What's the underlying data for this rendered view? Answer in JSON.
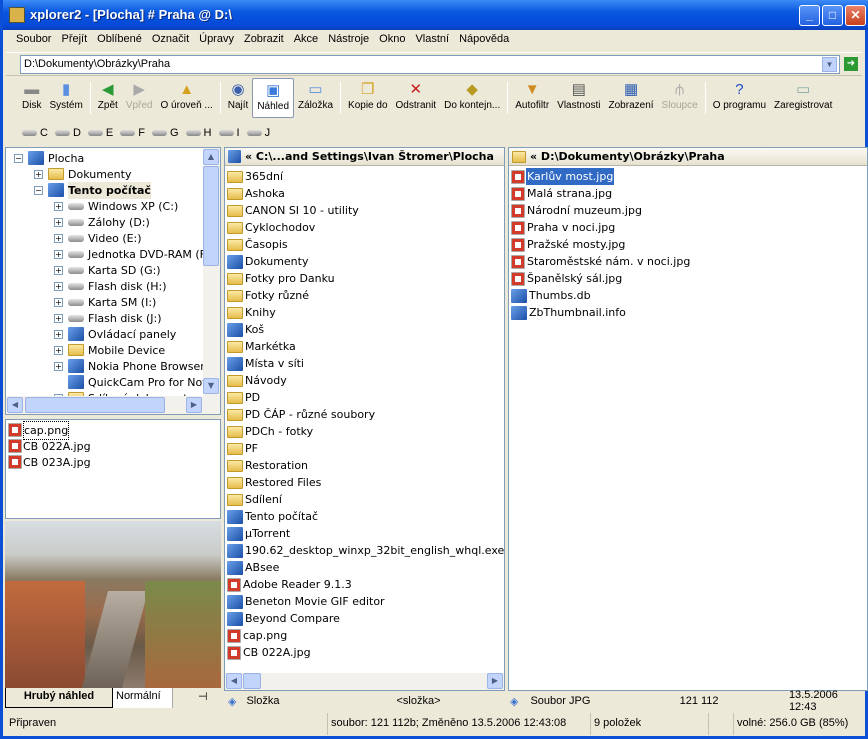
{
  "window": {
    "title": "xplorer2 - [Plocha] # Praha @ D:\\"
  },
  "menu": [
    "Soubor",
    "Přejít",
    "Oblíbené",
    "Označit",
    "Úpravy",
    "Zobrazit",
    "Akce",
    "Nástroje",
    "Okno",
    "Vlastní",
    "Nápověda"
  ],
  "address": {
    "value": "D:\\Dokumenty\\Obrázky\\Praha"
  },
  "toolbar": [
    {
      "label": "Disk",
      "icon": "disk-icon",
      "glyph": "▬",
      "color": "#888"
    },
    {
      "label": "Systém",
      "icon": "computer-icon",
      "glyph": "▮",
      "color": "#5a8ee0"
    },
    {
      "sep": true
    },
    {
      "label": "Zpět",
      "icon": "back-icon",
      "glyph": "◀",
      "color": "#2a9a36"
    },
    {
      "label": "Vpřed",
      "icon": "forward-icon",
      "glyph": "▶",
      "color": "#aaa",
      "disabled": true
    },
    {
      "label": "O úroveň ...",
      "icon": "up-folder-icon",
      "glyph": "▲",
      "color": "#d4a020"
    },
    {
      "sep": true
    },
    {
      "label": "Najít",
      "icon": "find-icon",
      "glyph": "◉",
      "color": "#3a5fae"
    },
    {
      "label": "Náhled",
      "icon": "preview-icon",
      "glyph": "▣",
      "color": "#3a7ad8",
      "active": true
    },
    {
      "label": "Záložka",
      "icon": "tab-icon",
      "glyph": "▭",
      "color": "#5a8ee0"
    },
    {
      "sep": true
    },
    {
      "label": "Kopie do",
      "icon": "copy-to-icon",
      "glyph": "❐",
      "color": "#d4a020"
    },
    {
      "label": "Odstranit",
      "icon": "delete-icon",
      "glyph": "✕",
      "color": "#c81e1e"
    },
    {
      "label": "Do kontejn...",
      "icon": "container-icon",
      "glyph": "◆",
      "color": "#b89a20"
    },
    {
      "sep": true
    },
    {
      "label": "Autofiltr",
      "icon": "filter-icon",
      "glyph": "▼",
      "color": "#d08a20"
    },
    {
      "label": "Vlastnosti",
      "icon": "properties-icon",
      "glyph": "▤",
      "color": "#555"
    },
    {
      "label": "Zobrazení",
      "icon": "view-icon",
      "glyph": "▦",
      "color": "#2a5ab0"
    },
    {
      "label": "Sloupce",
      "icon": "columns-icon",
      "glyph": "⫛",
      "color": "#aaa",
      "disabled": true
    },
    {
      "sep": true
    },
    {
      "label": "O programu",
      "icon": "help-icon",
      "glyph": "?",
      "color": "#1a4fc0"
    },
    {
      "label": "Zaregistrovat",
      "icon": "register-icon",
      "glyph": "▭",
      "color": "#8aa"
    }
  ],
  "drives": [
    "C",
    "D",
    "E",
    "F",
    "G",
    "H",
    "I",
    "J"
  ],
  "tree": [
    {
      "label": "Plocha",
      "level": 0,
      "exp": "-",
      "icon": "app"
    },
    {
      "label": "Dokumenty",
      "level": 1,
      "exp": "+",
      "icon": "fold"
    },
    {
      "label": "Tento počítač",
      "level": 1,
      "exp": "-",
      "icon": "app",
      "bold": true
    },
    {
      "label": "Windows XP (C:)",
      "level": 2,
      "exp": "+",
      "icon": "drvi"
    },
    {
      "label": "Zálohy (D:)",
      "level": 2,
      "exp": "+",
      "icon": "drvi"
    },
    {
      "label": "Video (E:)",
      "level": 2,
      "exp": "+",
      "icon": "drvi"
    },
    {
      "label": "Jednotka DVD-RAM (F:)",
      "level": 2,
      "exp": "+",
      "icon": "drvi"
    },
    {
      "label": "Karta SD (G:)",
      "level": 2,
      "exp": "+",
      "icon": "drvi"
    },
    {
      "label": "Flash disk (H:)",
      "level": 2,
      "exp": "+",
      "icon": "drvi"
    },
    {
      "label": "Karta SM (I:)",
      "level": 2,
      "exp": "+",
      "icon": "drvi"
    },
    {
      "label": "Flash disk (J:)",
      "level": 2,
      "exp": "+",
      "icon": "drvi"
    },
    {
      "label": "Ovládací panely",
      "level": 2,
      "exp": "+",
      "icon": "app"
    },
    {
      "label": "Mobile Device",
      "level": 2,
      "exp": "+",
      "icon": "fold"
    },
    {
      "label": "Nokia Phone Browser",
      "level": 2,
      "exp": "+",
      "icon": "app"
    },
    {
      "label": "QuickCam Pro for Notebooks",
      "level": 2,
      "exp": "",
      "icon": "app"
    },
    {
      "label": "Sdílené dokumenty",
      "level": 2,
      "exp": "+",
      "icon": "fold"
    }
  ],
  "mini_list": [
    "cap.png",
    "CB 022A.jpg",
    "CB 023A.jpg"
  ],
  "preview_tabs": [
    "Hrubý náhled",
    "Normální"
  ],
  "left_pane": {
    "header": "« C:\\...and Settings\\Ivan Štromer\\Plocha",
    "items": [
      {
        "n": "365dní",
        "t": "fold"
      },
      {
        "n": "Ashoka",
        "t": "fold"
      },
      {
        "n": "CANON SI 10 - utility",
        "t": "fold"
      },
      {
        "n": "Cyklochodov",
        "t": "fold"
      },
      {
        "n": "Časopis",
        "t": "fold"
      },
      {
        "n": "Dokumenty",
        "t": "app"
      },
      {
        "n": "Fotky pro Danku",
        "t": "fold"
      },
      {
        "n": "Fotky různé",
        "t": "fold"
      },
      {
        "n": "Knihy",
        "t": "fold"
      },
      {
        "n": "Koš",
        "t": "app"
      },
      {
        "n": "Markétka",
        "t": "fold"
      },
      {
        "n": "Místa v síti",
        "t": "app"
      },
      {
        "n": "Návody",
        "t": "fold"
      },
      {
        "n": "PD",
        "t": "fold"
      },
      {
        "n": "PD ČÁP - různé soubory",
        "t": "fold"
      },
      {
        "n": "PDCh - fotky",
        "t": "fold"
      },
      {
        "n": "PF",
        "t": "fold"
      },
      {
        "n": "Restoration",
        "t": "fold"
      },
      {
        "n": "Restored Files",
        "t": "fold"
      },
      {
        "n": "Sdílení",
        "t": "fold"
      },
      {
        "n": "Tento počítač",
        "t": "app"
      },
      {
        "n": "µTorrent",
        "t": "app"
      },
      {
        "n": "190.62_desktop_winxp_32bit_english_whql.exe",
        "t": "app"
      },
      {
        "n": "ABsee",
        "t": "app"
      },
      {
        "n": "Adobe Reader 9.1.3",
        "t": "img"
      },
      {
        "n": "Beneton Movie GIF editor",
        "t": "app"
      },
      {
        "n": "Beyond Compare",
        "t": "app"
      },
      {
        "n": "cap.png",
        "t": "img"
      },
      {
        "n": "CB 022A.jpg",
        "t": "img"
      }
    ],
    "info": [
      "Složka",
      "<složka>"
    ]
  },
  "right_pane": {
    "header": "« D:\\Dokumenty\\Obrázky\\Praha",
    "items": [
      {
        "n": "Karlův most.jpg",
        "t": "img",
        "sel": true
      },
      {
        "n": "Malá strana.jpg",
        "t": "img"
      },
      {
        "n": "Národní muzeum.jpg",
        "t": "img"
      },
      {
        "n": "Praha v noci.jpg",
        "t": "img"
      },
      {
        "n": "Pražské mosty.jpg",
        "t": "img"
      },
      {
        "n": "Staroměstské nám. v noci.jpg",
        "t": "img"
      },
      {
        "n": "Španělský sál.jpg",
        "t": "img"
      },
      {
        "n": "Thumbs.db",
        "t": "app"
      },
      {
        "n": "ZbThumbnail.info",
        "t": "app"
      }
    ],
    "info": [
      "Soubor JPG",
      "121 112",
      "13.5.2006 12:43"
    ]
  },
  "status": {
    "ready": "Připraven",
    "file": "soubor: 121 112b; Změněno 13.5.2006 12:43:08",
    "count": "9 položek",
    "free": "volné: 256.0 GB (85%)"
  }
}
